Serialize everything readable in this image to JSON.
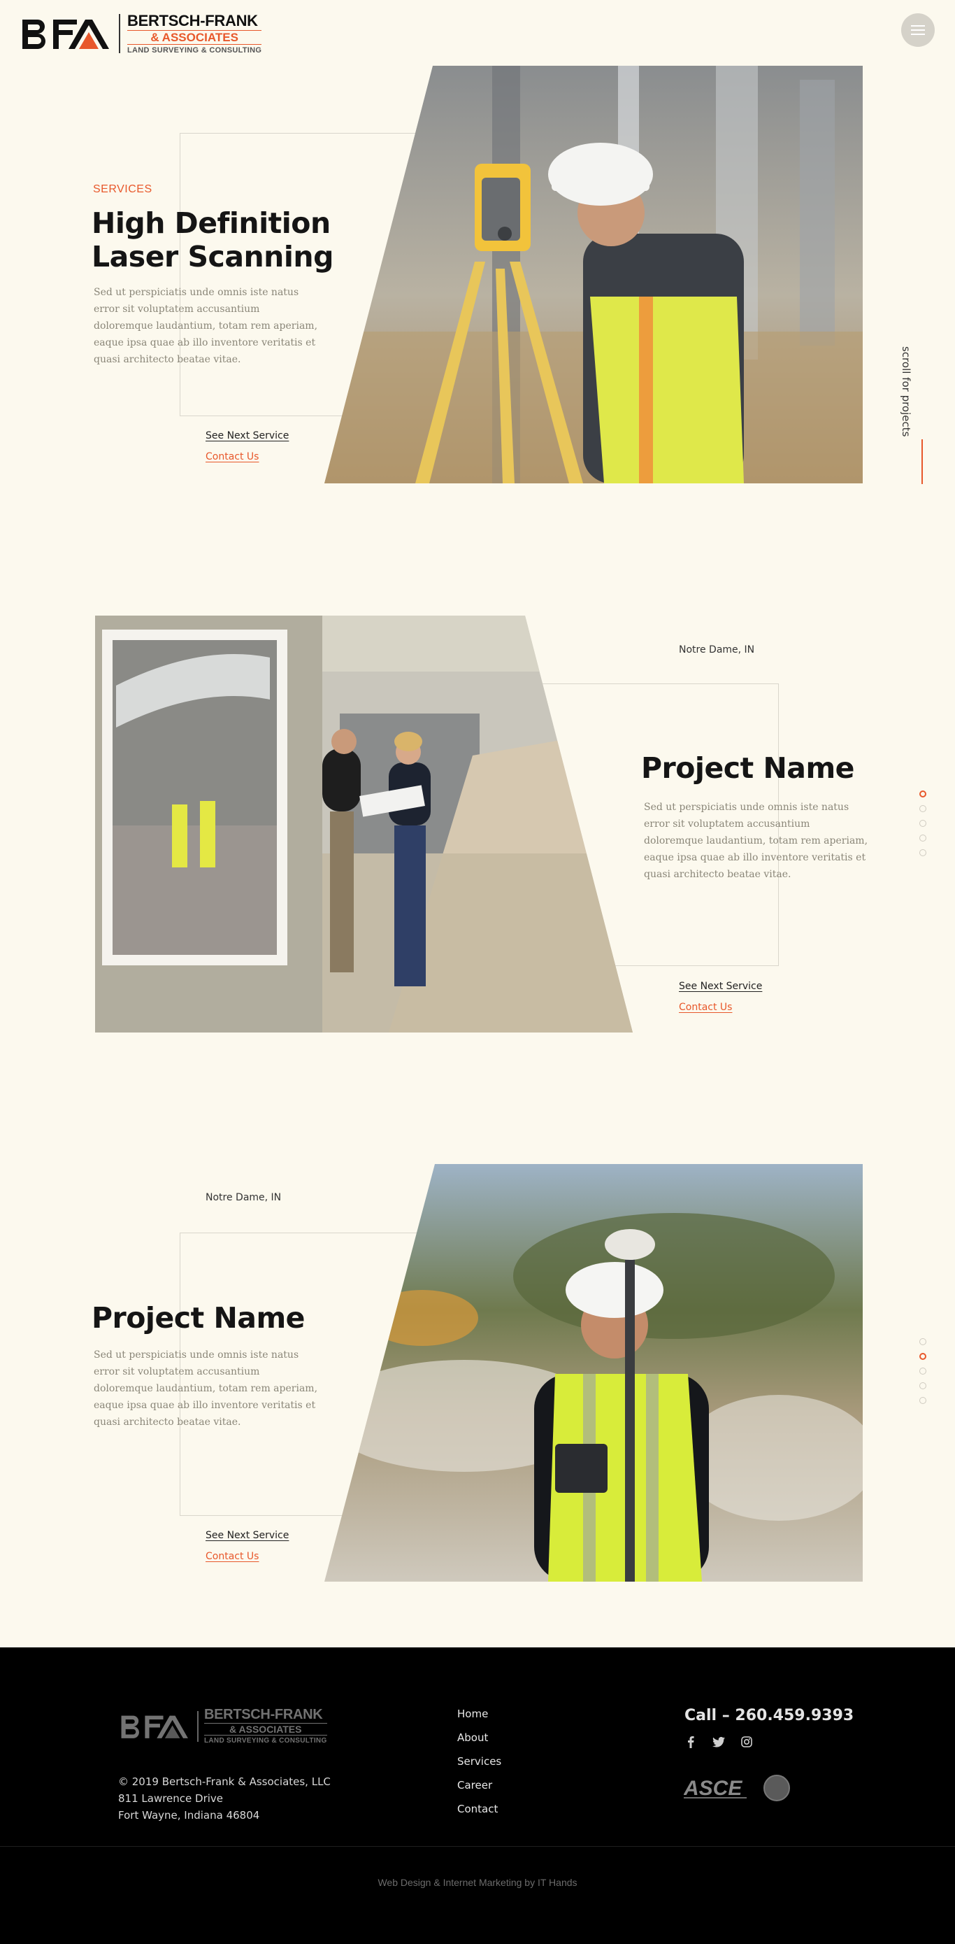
{
  "brand": {
    "name": "BERTSCH-FRANK",
    "associates": "& ASSOCIATES",
    "tagline": "LAND SURVEYING & CONSULTING",
    "accent_color": "#e8582b"
  },
  "header": {
    "menu_icon": "hamburger-icon"
  },
  "scroll_hint": "scroll for projects",
  "sections": [
    {
      "eyebrow": "SERVICES",
      "title_line1": "High Definition",
      "title_line2": "Laser Scanning",
      "description": "Sed ut perspiciatis unde omnis iste natus error sit voluptatem accusantium doloremque laudantium, totam rem aperiam, eaque ipsa quae ab illo inventore veritatis et quasi architecto beatae vitae.",
      "next_label": "See Next Service",
      "contact_label": "Contact Us"
    },
    {
      "location": "Notre Dame, IN",
      "title": "Project Name",
      "description": "Sed ut perspiciatis unde omnis iste natus error sit voluptatem accusantium doloremque laudantium, totam rem aperiam, eaque ipsa quae ab illo inventore veritatis et quasi architecto beatae vitae.",
      "next_label": "See Next Service",
      "contact_label": "Contact Us",
      "active_dot": 1
    },
    {
      "location": "Notre Dame, IN",
      "title": "Project Name",
      "description": "Sed ut perspiciatis unde omnis iste natus error sit voluptatem accusantium doloremque laudantium, totam rem aperiam, eaque ipsa quae ab illo inventore veritatis et quasi architecto beatae vitae.",
      "next_label": "See Next Service",
      "contact_label": "Contact Us",
      "active_dot": 2
    }
  ],
  "footer": {
    "copyright": "© 2019 Bertsch-Frank & Associates, LLC",
    "address1": "811 Lawrence Drive",
    "address2": "Fort Wayne, Indiana 46804",
    "nav": [
      "Home",
      "About",
      "Services",
      "Career",
      "Contact"
    ],
    "call": "Call – 260.459.9393",
    "social_icons": [
      "facebook-icon",
      "twitter-icon",
      "instagram-icon"
    ],
    "affiliation": "ASCE",
    "credit": "Web Design & Internet Marketing by IT Hands"
  }
}
